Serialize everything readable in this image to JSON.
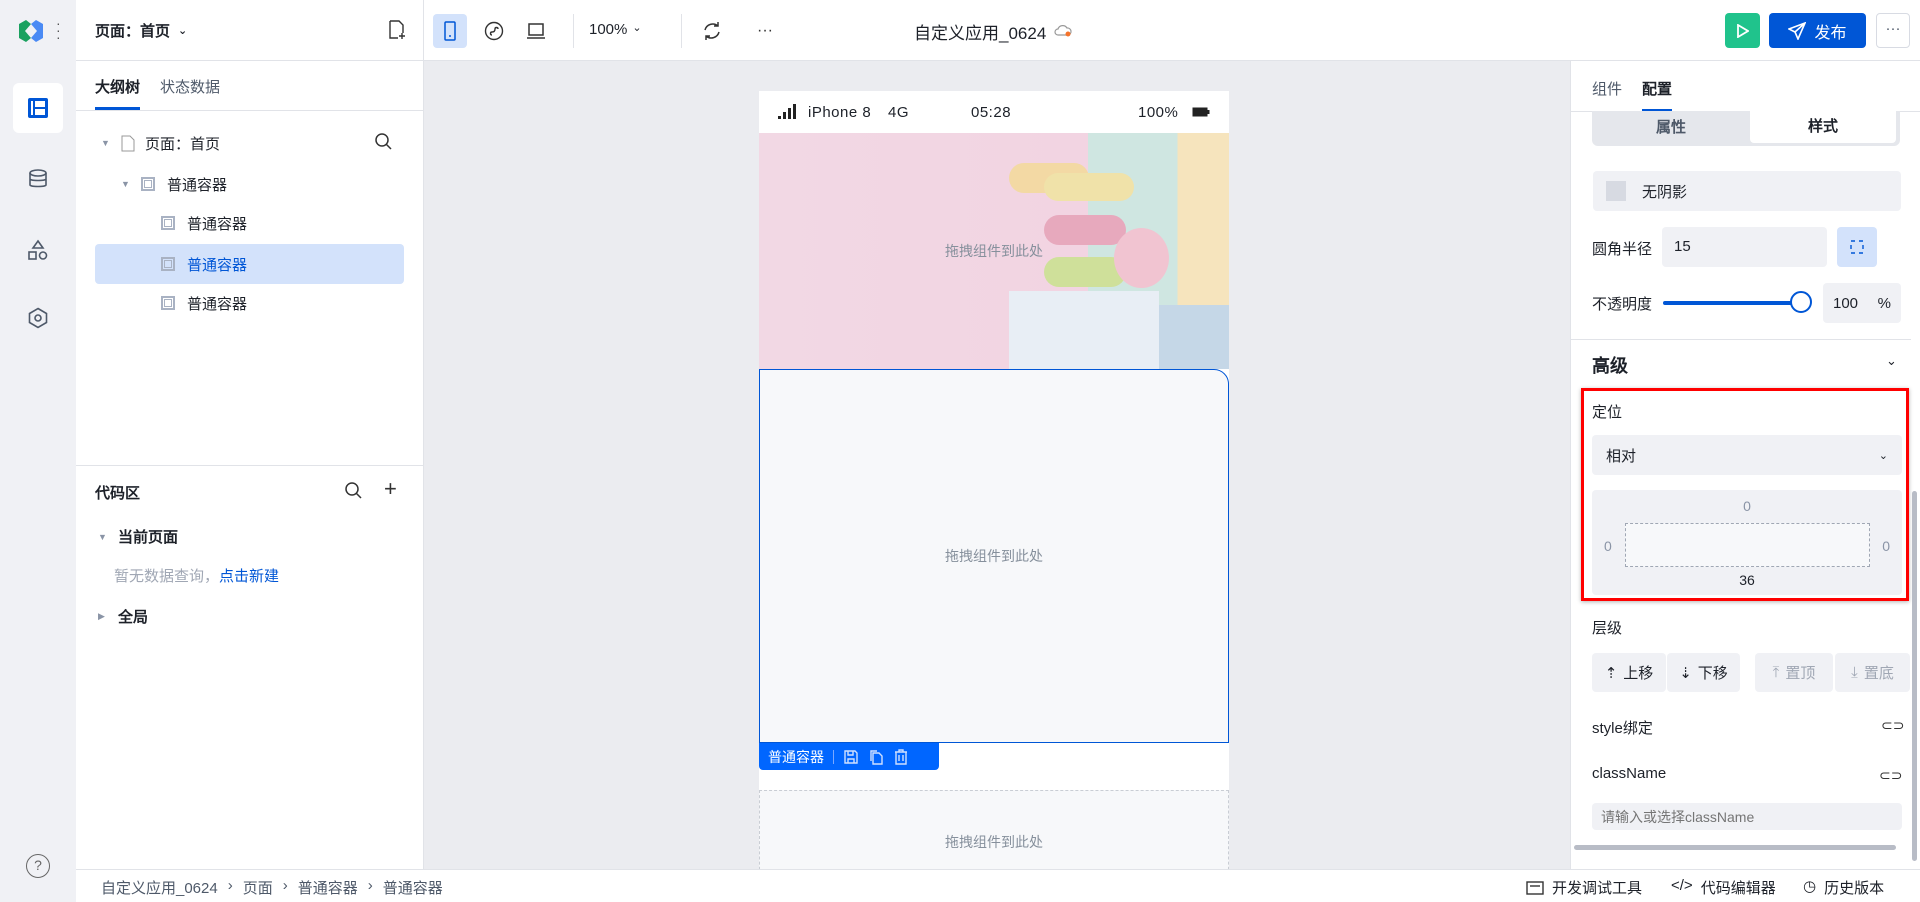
{
  "app": {
    "title": "自定义应用_0624",
    "accent": "#0056d6",
    "run_color": "#20c38c"
  },
  "left": {
    "page_select": "页面：首页",
    "tabs": [
      "大纲树",
      "状态数据"
    ],
    "tree": [
      {
        "label": "页面：首页",
        "level": 0
      },
      {
        "label": "普通容器",
        "level": 1
      },
      {
        "label": "普通容器",
        "level": 2
      },
      {
        "label": "普通容器",
        "level": 2,
        "selected": true
      },
      {
        "label": "普通容器",
        "level": 2
      }
    ],
    "code": {
      "title": "代码区",
      "current_page": "当前页面",
      "empty_text": "暂无数据查询，",
      "create_link": "点击新建",
      "global": "全局"
    }
  },
  "toolbar": {
    "zoom": "100%",
    "publish": "发布"
  },
  "phone": {
    "device": "iPhone 8",
    "network": "4G",
    "time": "05:28",
    "battery": "100%",
    "drop_hint": "拖拽组件到此处",
    "selected_label": "普通容器"
  },
  "right": {
    "tabs": [
      "组件",
      "配置"
    ],
    "segments": [
      "属性",
      "样式"
    ],
    "shadow": "无阴影",
    "radius_label": "圆角半径",
    "radius": "15",
    "opacity_label": "不透明度",
    "opacity": "100",
    "opacity_unit": "%",
    "opacity_fraction": 1.0,
    "advanced": "高级",
    "position_label": "定位",
    "position_value": "相对",
    "offsets": {
      "top": "0",
      "left": "0",
      "right": "0",
      "bottom": "36"
    },
    "layer_label": "层级",
    "layer_buttons": [
      "上移",
      "下移",
      "置顶",
      "置底"
    ],
    "style_bind": "style绑定",
    "classname_label": "className",
    "classname_placeholder": "请输入或选择className"
  },
  "bottom": {
    "breadcrumb": [
      "自定义应用_0624",
      "页面",
      "普通容器",
      "普通容器"
    ],
    "tools": [
      "开发调试工具",
      "代码编辑器",
      "历史版本"
    ]
  }
}
